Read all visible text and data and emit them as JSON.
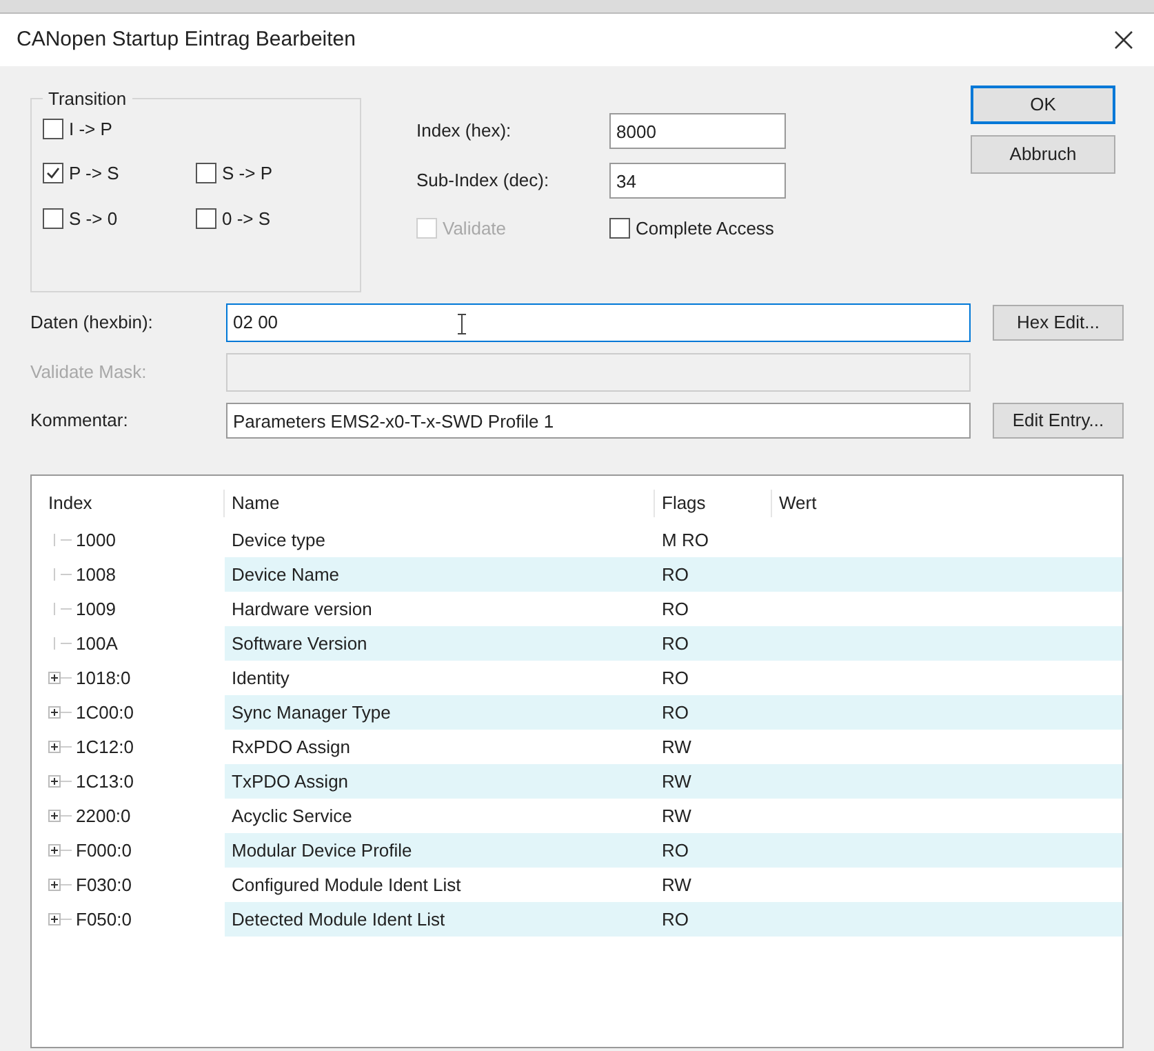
{
  "window": {
    "title": "CANopen Startup Eintrag Bearbeiten"
  },
  "transition": {
    "title": "Transition",
    "options": [
      {
        "label": "I -> P",
        "checked": false
      },
      {
        "label": "P -> S",
        "checked": true
      },
      {
        "label": "S -> P",
        "checked": false
      },
      {
        "label": "S -> 0",
        "checked": false
      },
      {
        "label": "0 -> S",
        "checked": false
      }
    ]
  },
  "index": {
    "label": "Index (hex):",
    "value": "8000"
  },
  "sub_index": {
    "label": "Sub-Index (dec):",
    "value": "34"
  },
  "validate": {
    "label": "Validate",
    "checked": false,
    "disabled": true
  },
  "complete_access": {
    "label": "Complete Access",
    "checked": false
  },
  "buttons": [
    {
      "label": "OK",
      "default": true
    },
    {
      "label": "Abbruch",
      "default": false
    }
  ],
  "daten": {
    "label": "Daten (hexbin):",
    "value": "02 00",
    "button": "Hex Edit..."
  },
  "validate_mask": {
    "label": "Validate Mask:",
    "disabled": true
  },
  "kommentar": {
    "label": "Kommentar:",
    "value": "Parameters EMS2-x0-T-x-SWD Profile 1",
    "button": "Edit Entry..."
  },
  "table": {
    "columns": [
      "Index",
      "Name",
      "Flags",
      "Wert"
    ],
    "rows": [
      {
        "index": "1000",
        "name": "Device type",
        "flags": "M RO",
        "expandable": false
      },
      {
        "index": "1008",
        "name": "Device Name",
        "flags": "RO",
        "expandable": false
      },
      {
        "index": "1009",
        "name": "Hardware version",
        "flags": "RO",
        "expandable": false
      },
      {
        "index": "100A",
        "name": "Software Version",
        "flags": "RO",
        "expandable": false
      },
      {
        "index": "1018:0",
        "name": "Identity",
        "flags": "RO",
        "expandable": true
      },
      {
        "index": "1C00:0",
        "name": "Sync Manager Type",
        "flags": "RO",
        "expandable": true
      },
      {
        "index": "1C12:0",
        "name": "RxPDO Assign",
        "flags": "RW",
        "expandable": true
      },
      {
        "index": "1C13:0",
        "name": "TxPDO Assign",
        "flags": "RW",
        "expandable": true
      },
      {
        "index": "2200:0",
        "name": "Acyclic Service",
        "flags": "RW",
        "expandable": true
      },
      {
        "index": "F000:0",
        "name": "Modular Device Profile",
        "flags": "RO",
        "expandable": true
      },
      {
        "index": "F030:0",
        "name": "Configured Module Ident List",
        "flags": "RW",
        "expandable": true
      },
      {
        "index": "F050:0",
        "name": "Detected Module Ident List",
        "flags": "RO",
        "expandable": true
      }
    ]
  }
}
